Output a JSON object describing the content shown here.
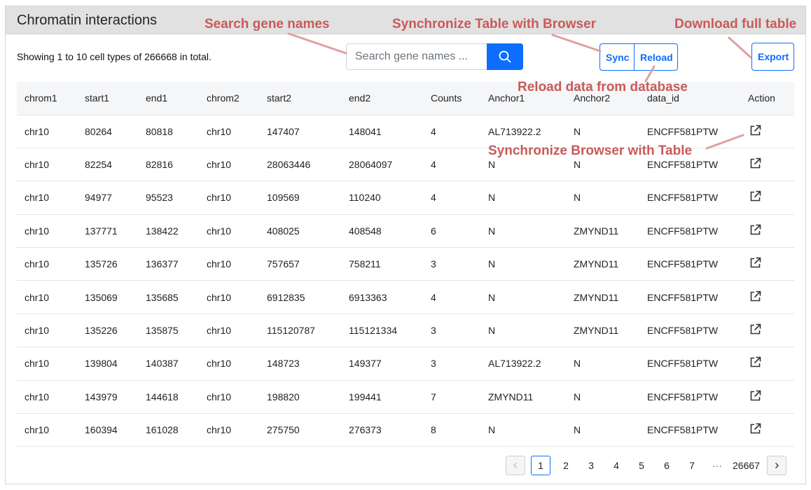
{
  "panel": {
    "title": "Chromatin interactions"
  },
  "summary": "Showing 1 to 10 cell types of 266668 in total.",
  "search": {
    "placeholder": "Search gene names ...",
    "icon": "search-icon"
  },
  "buttons": {
    "sync": "Sync",
    "reload": "Reload",
    "export": "Export"
  },
  "table": {
    "columns": [
      "chrom1",
      "start1",
      "end1",
      "chrom2",
      "start2",
      "end2",
      "Counts",
      "Anchor1",
      "Anchor2",
      "data_id",
      "Action"
    ],
    "rows": [
      [
        "chr10",
        "80264",
        "80818",
        "chr10",
        "147407",
        "148041",
        "4",
        "AL713922.2",
        "N",
        "ENCFF581PTW"
      ],
      [
        "chr10",
        "82254",
        "82816",
        "chr10",
        "28063446",
        "28064097",
        "4",
        "N",
        "N",
        "ENCFF581PTW"
      ],
      [
        "chr10",
        "94977",
        "95523",
        "chr10",
        "109569",
        "110240",
        "4",
        "N",
        "N",
        "ENCFF581PTW"
      ],
      [
        "chr10",
        "137771",
        "138422",
        "chr10",
        "408025",
        "408548",
        "6",
        "N",
        "ZMYND11",
        "ENCFF581PTW"
      ],
      [
        "chr10",
        "135726",
        "136377",
        "chr10",
        "757657",
        "758211",
        "3",
        "N",
        "ZMYND11",
        "ENCFF581PTW"
      ],
      [
        "chr10",
        "135069",
        "135685",
        "chr10",
        "6912835",
        "6913363",
        "4",
        "N",
        "ZMYND11",
        "ENCFF581PTW"
      ],
      [
        "chr10",
        "135226",
        "135875",
        "chr10",
        "115120787",
        "115121334",
        "3",
        "N",
        "ZMYND11",
        "ENCFF581PTW"
      ],
      [
        "chr10",
        "139804",
        "140387",
        "chr10",
        "148723",
        "149377",
        "3",
        "AL713922.2",
        "N",
        "ENCFF581PTW"
      ],
      [
        "chr10",
        "143979",
        "144618",
        "chr10",
        "198820",
        "199441",
        "7",
        "ZMYND11",
        "N",
        "ENCFF581PTW"
      ],
      [
        "chr10",
        "160394",
        "161028",
        "chr10",
        "275750",
        "276373",
        "8",
        "N",
        "N",
        "ENCFF581PTW"
      ]
    ],
    "action_icon": "external-link-icon"
  },
  "pagination": {
    "prev_icon": "chevron-left-icon",
    "next_icon": "chevron-right-icon",
    "pages": [
      "1",
      "2",
      "3",
      "4",
      "5",
      "6",
      "7"
    ],
    "current": "1",
    "ellipsis": "···",
    "last": "26667"
  },
  "annotations": {
    "search": "Search gene names",
    "sync": "Synchronize Table with Browser",
    "export": "Download full table",
    "reload": "Reload data from database",
    "action": "Synchronize Browser with Table"
  },
  "colors": {
    "accent": "#0d6efd",
    "annotation": "#c95a59",
    "header_bg": "#e1e1e1"
  }
}
